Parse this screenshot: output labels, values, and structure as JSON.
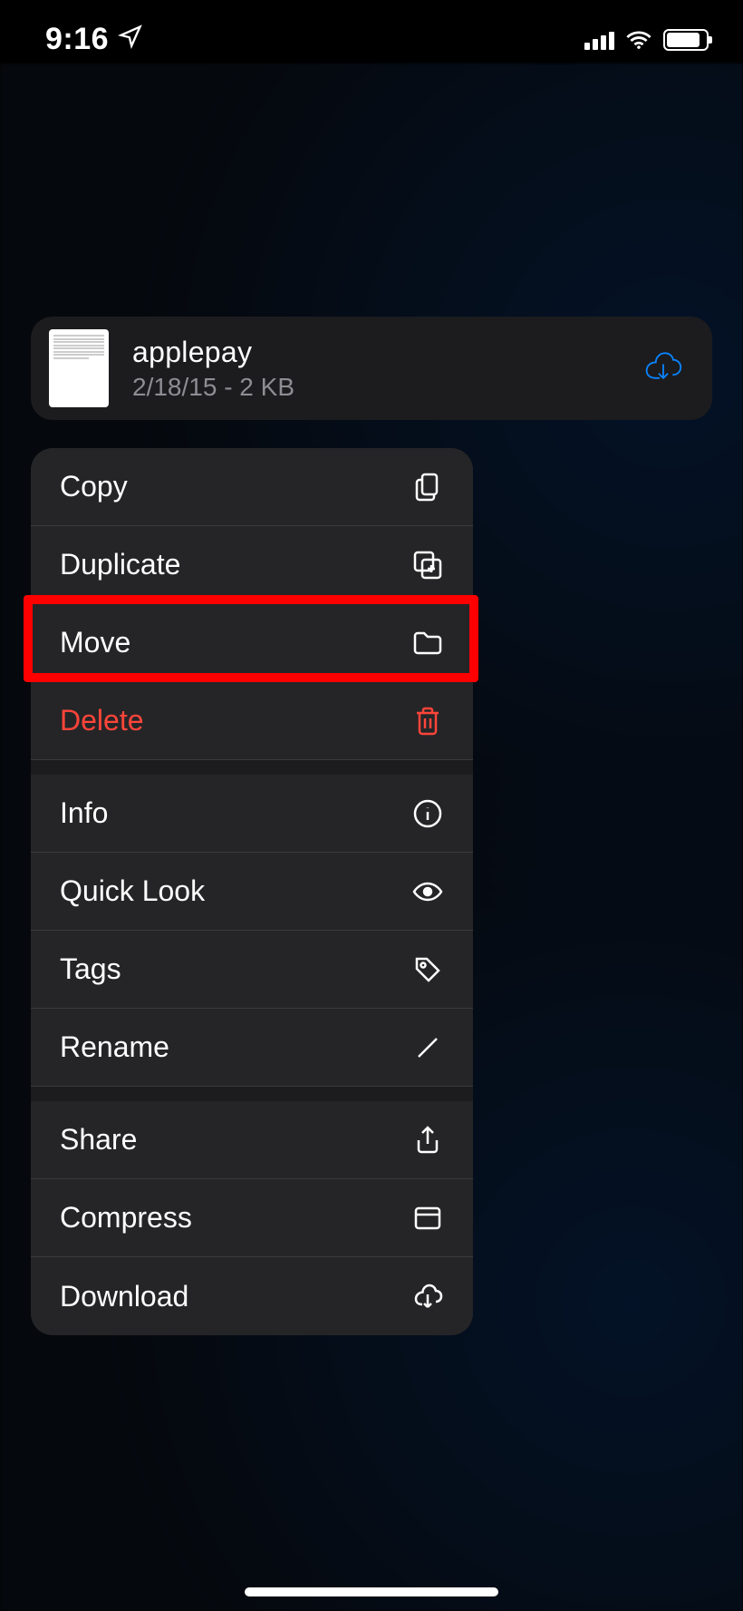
{
  "status": {
    "time": "9:16"
  },
  "file": {
    "name": "applepay",
    "meta": "2/18/15 - 2 KB"
  },
  "menu": {
    "items": [
      {
        "label": "Copy",
        "icon": "copy-icon",
        "destructive": false,
        "highlighted": false
      },
      {
        "label": "Duplicate",
        "icon": "duplicate-icon",
        "destructive": false,
        "highlighted": false
      },
      {
        "label": "Move",
        "icon": "folder-icon",
        "destructive": false,
        "highlighted": true
      },
      {
        "label": "Delete",
        "icon": "trash-icon",
        "destructive": true,
        "highlighted": false
      },
      {
        "label": "Info",
        "icon": "info-icon",
        "destructive": false,
        "highlighted": false
      },
      {
        "label": "Quick Look",
        "icon": "eye-icon",
        "destructive": false,
        "highlighted": false
      },
      {
        "label": "Tags",
        "icon": "tag-icon",
        "destructive": false,
        "highlighted": false
      },
      {
        "label": "Rename",
        "icon": "pencil-icon",
        "destructive": false,
        "highlighted": false
      },
      {
        "label": "Share",
        "icon": "share-icon",
        "destructive": false,
        "highlighted": false
      },
      {
        "label": "Compress",
        "icon": "archive-icon",
        "destructive": false,
        "highlighted": false
      },
      {
        "label": "Download",
        "icon": "cloud-down-icon",
        "destructive": false,
        "highlighted": false
      }
    ]
  }
}
